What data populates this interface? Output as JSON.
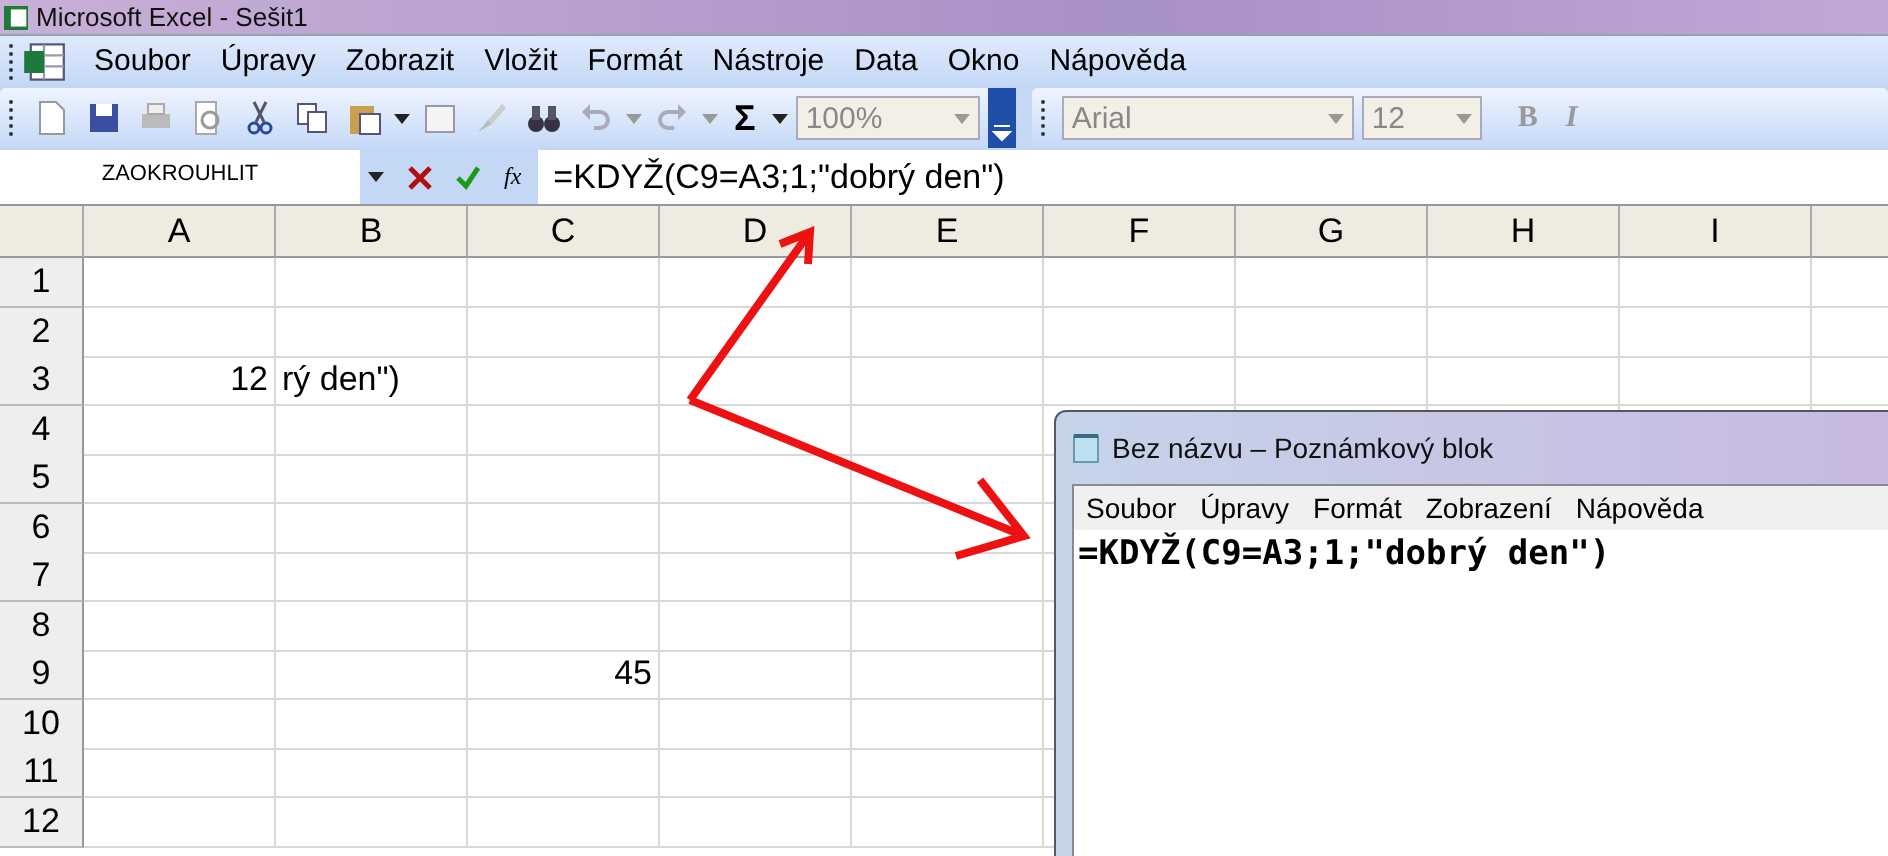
{
  "window": {
    "title": "Microsoft Excel - Sešit1"
  },
  "menu": [
    "Soubor",
    "Úpravy",
    "Zobrazit",
    "Vložit",
    "Formát",
    "Nástroje",
    "Data",
    "Okno",
    "Nápověda"
  ],
  "toolbar": {
    "sum": "Σ",
    "zoom": "100%",
    "font": "Arial",
    "size": "12",
    "bold": "B",
    "italic": "I"
  },
  "formula_bar": {
    "name_box": "ZAOKROUHLIT",
    "fx": "fx",
    "formula": "=KDYŽ(C9=A3;1;\"dobrý den\")"
  },
  "columns": [
    "A",
    "B",
    "C",
    "D",
    "E",
    "F",
    "G",
    "H",
    "I"
  ],
  "rows": [
    {
      "header": "1"
    },
    {
      "header": "2"
    },
    {
      "header": "3",
      "cells": {
        "A": {
          "text": "12",
          "kind": "number"
        },
        "B": {
          "text": "rý den\")",
          "kind": "text"
        }
      }
    },
    {
      "header": "4"
    },
    {
      "header": "5"
    },
    {
      "header": "6"
    },
    {
      "header": "7"
    },
    {
      "header": "8"
    },
    {
      "header": "9",
      "cells": {
        "C": {
          "text": "45",
          "kind": "number"
        }
      }
    },
    {
      "header": "10"
    },
    {
      "header": "11"
    },
    {
      "header": "12"
    }
  ],
  "notepad": {
    "title": "Bez názvu – Poznámkový blok",
    "menu": [
      "Soubor",
      "Úpravy",
      "Formát",
      "Zobrazení",
      "Nápověda"
    ],
    "text": "=KDYŽ(C9=A3;1;\"dobrý den\")"
  }
}
